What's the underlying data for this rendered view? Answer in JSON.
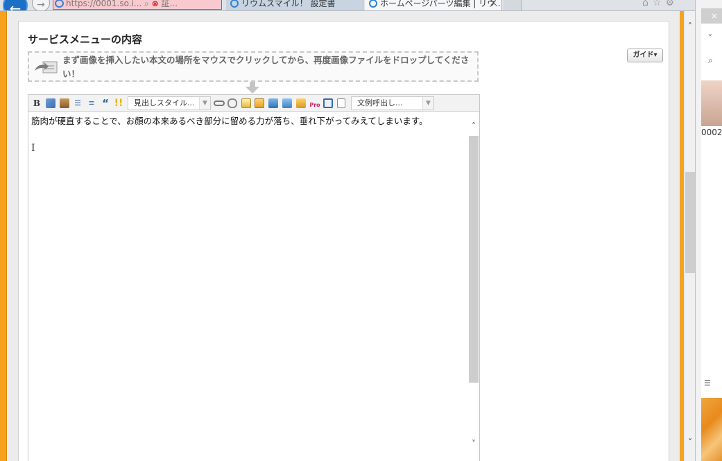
{
  "browser": {
    "address_text": "https://0001.so.i...",
    "cert_error_label": "証...",
    "tabs": [
      {
        "label": "リウムスマイル！ 設定書"
      },
      {
        "label": "ホームページパーツ編集 | リウ...",
        "close": "×"
      }
    ],
    "toolbar_icons": "⌂☆⚙"
  },
  "panel": {
    "title": "サービスメニューの内容",
    "guide_label": "ガイド▾",
    "drop_zone": {
      "text": "まず画像を挿入したい本文の場所をマウスでクリックしてから、再度画像ファイルをドロップしてください！"
    }
  },
  "editor": {
    "toolbar": {
      "bold_label": "B",
      "quote_label": "“",
      "heading_style": "見出しスタイル...",
      "template_call": "文例呼出し..."
    },
    "body_text": "筋肉が硬直することで、お顔の本来あるべき部分に留める力が落ち、垂れ下がってみえてしまいます。",
    "text_cursor": "I"
  },
  "side_window": {
    "close": "×",
    "item_number": "0002"
  },
  "icons": {
    "back": "back-arrow-icon",
    "forward": "forward-arrow-icon",
    "scroll_up": "chevron-up-icon",
    "scroll_down": "chevron-down-icon"
  },
  "colors": {
    "accent_orange": "#f6a21e",
    "address_error_bg": "#f8c9ce",
    "back_button_blue": "#1b6fc7"
  }
}
